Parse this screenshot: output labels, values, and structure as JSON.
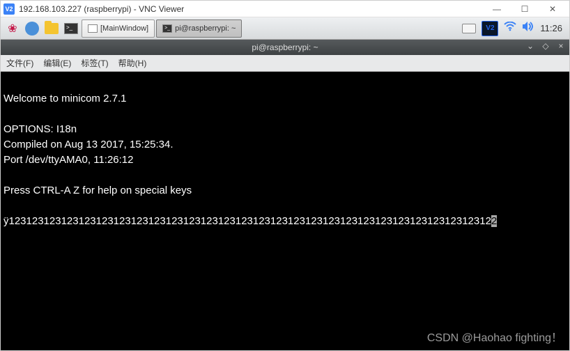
{
  "vncViewer": {
    "badge": "V2",
    "title": "192.168.103.227 (raspberrypi) - VNC Viewer",
    "minimize": "—",
    "maximize": "☐",
    "close": "✕"
  },
  "taskbar": {
    "mainWindowLabel": "[MainWindow]",
    "termTaskLabel": "pi@raspberrypi: ~",
    "clock": "11:26"
  },
  "terminal": {
    "title": "pi@raspberrypi: ~",
    "controls": {
      "min": "⌄",
      "max": "◇",
      "close": "×"
    },
    "menu": {
      "file": "文件(F)",
      "edit": "编辑(E)",
      "tabs": "标签(T)",
      "help": "帮助(H)"
    },
    "lines": {
      "l0": "",
      "l1": "Welcome to minicom 2.7.1",
      "l2": "",
      "l3": "OPTIONS: I18n",
      "l4": "Compiled on Aug 13 2017, 15:25:34.",
      "l5": "Port /dev/ttyAMA0, 11:26:12",
      "l6": "",
      "l7": "Press CTRL-A Z for help on special keys",
      "l8": "",
      "l9": "ÿ12312312312312312312312312312312312312312312312312312312312312312312312312312312312",
      "cursor": "2"
    }
  },
  "watermark": "CSDN @Haohao fighting！"
}
